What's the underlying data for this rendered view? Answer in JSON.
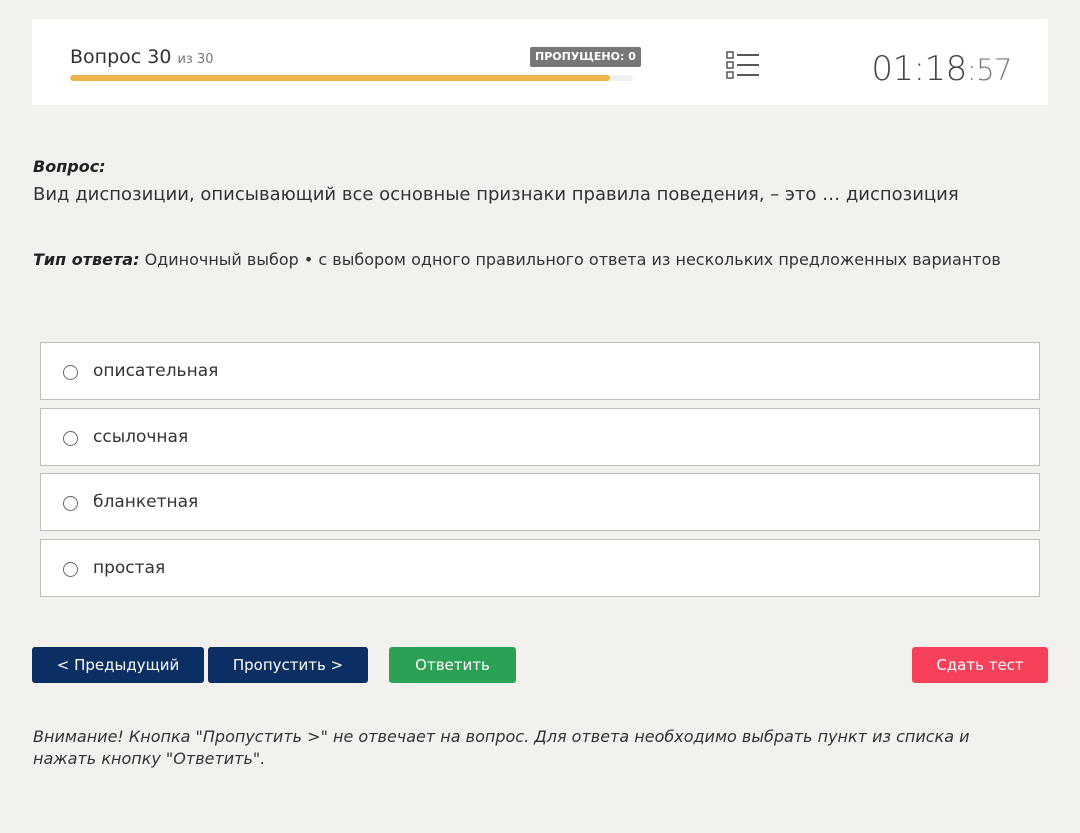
{
  "header": {
    "question_prefix": "Вопрос 30",
    "question_of": "из 30",
    "skipped_badge": "ПРОПУЩЕНО: 0",
    "progress_fraction": 0.96,
    "list_icon": "list-icon",
    "timer_main": "01:18",
    "timer_sep": ":",
    "timer_seconds": "57"
  },
  "question": {
    "label": "Вопрос:",
    "text": "Вид диспозиции, описывающий все основные признаки правила поведения, – это … диспозиция"
  },
  "answer_type": {
    "label": "Тип ответа:",
    "value": "Одиночный выбор • с выбором одного правильного ответа из нескольких предложенных вариантов"
  },
  "options": [
    {
      "label": "описательная"
    },
    {
      "label": "ссылочная"
    },
    {
      "label": "бланкетная"
    },
    {
      "label": "простая"
    }
  ],
  "buttons": {
    "prev": "< Предыдущий",
    "skip": "Пропустить >",
    "answer": "Ответить",
    "submit": "Сдать тест"
  },
  "notice": "Внимание! Кнопка \"Пропустить >\" не отвечает на вопрос. Для ответа необходимо выбрать пункт из списка и нажать кнопку \"Ответить\".",
  "colors": {
    "background": "#f2f1ee",
    "progress": "#efb54a",
    "nav_button": "#0c2f63",
    "answer_button": "#2aa154",
    "submit_button": "#f7415a"
  }
}
